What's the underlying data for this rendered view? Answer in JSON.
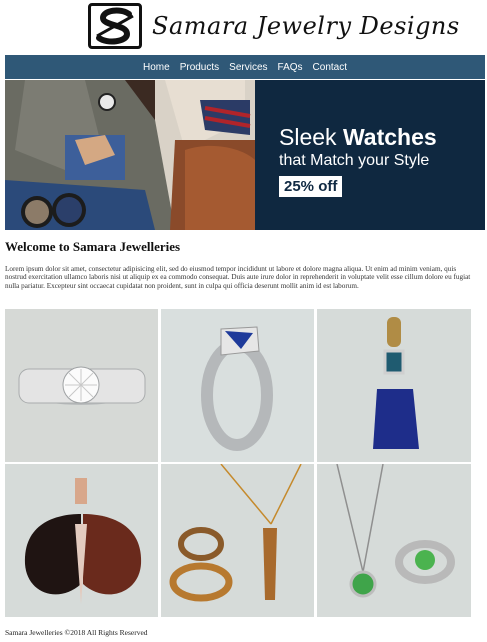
{
  "brand": {
    "logo_letter": "S",
    "name": "Samara Jewelry Designs"
  },
  "nav": {
    "items": [
      "Home",
      "Products",
      "Services",
      "FAQs",
      "Contact"
    ]
  },
  "banner": {
    "head_light": "Sleek",
    "head_bold": "Watches",
    "sub": "that Match your Style",
    "badge": "25% off"
  },
  "main": {
    "title": "Welcome to Samara Jewelleries",
    "body": "Lorem ipsum dolor sit amet, consectetur adipisicing elit, sed do eiusmod tempor incididunt ut labore et dolore magna aliqua. Ut enim ad minim veniam, quis nostrud exercitation ullamco laboris nisi ut aliquip ex ea commodo consequat. Duis aute irure dolor in reprehenderit in voluptate velit esse cillum dolore eu fugiat nulla pariatur. Excepteur sint occaecat cupidatat non proident, sunt in culpa qui officia deserunt mollit anim id est laborum."
  },
  "products": [
    "diamond-ring",
    "sapphire-ring",
    "lapis-pendant",
    "butterfly-pendant",
    "gold-jewelry-set",
    "emerald-necklace-ring"
  ],
  "footer": {
    "text": "Samara Jewelleries ©2018 All Rights Reserved"
  }
}
